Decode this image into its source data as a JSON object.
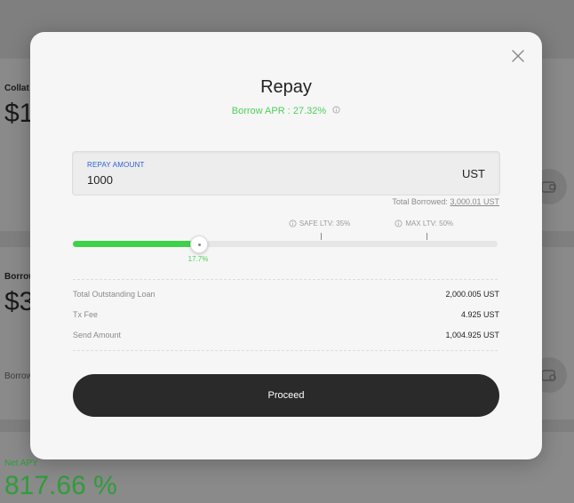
{
  "background": {
    "collateral_label": "Collat",
    "collateral_value": "$1",
    "borrow_label": "Borrow",
    "borrow_value": "$3",
    "borrow_small": "Borrow",
    "net_apy_label": "Net APY",
    "net_apy_value": "817.66 %",
    "icons": [
      "wallet-icon",
      "wallet-settings-icon"
    ]
  },
  "modal": {
    "title": "Repay",
    "borrow_apr": "Borrow APR : 27.32%",
    "close_icon": "close-icon",
    "input": {
      "label": "REPAY AMOUNT",
      "value": "1000",
      "unit": "UST"
    },
    "total_borrowed_label": "Total Borrowed:",
    "total_borrowed_amount": "3,000.01 UST",
    "ltv": {
      "safe_label": "SAFE LTV: 35%",
      "max_label": "MAX LTV: 50%",
      "current_label": "17.7%",
      "current": 17.7,
      "safe": 35,
      "max": 50,
      "scale_max": 60
    },
    "rows": [
      {
        "label": "Total Outstanding Loan",
        "value": "2,000.005 UST"
      },
      {
        "label": "Tx Fee",
        "value": "4.925 UST"
      },
      {
        "label": "Send Amount",
        "value": "1,004.925 UST"
      }
    ],
    "proceed_label": "Proceed"
  },
  "colors": {
    "accent_green": "#3ed24a",
    "label_blue": "#2b5fd6",
    "button_dark": "#2a2a2a"
  }
}
